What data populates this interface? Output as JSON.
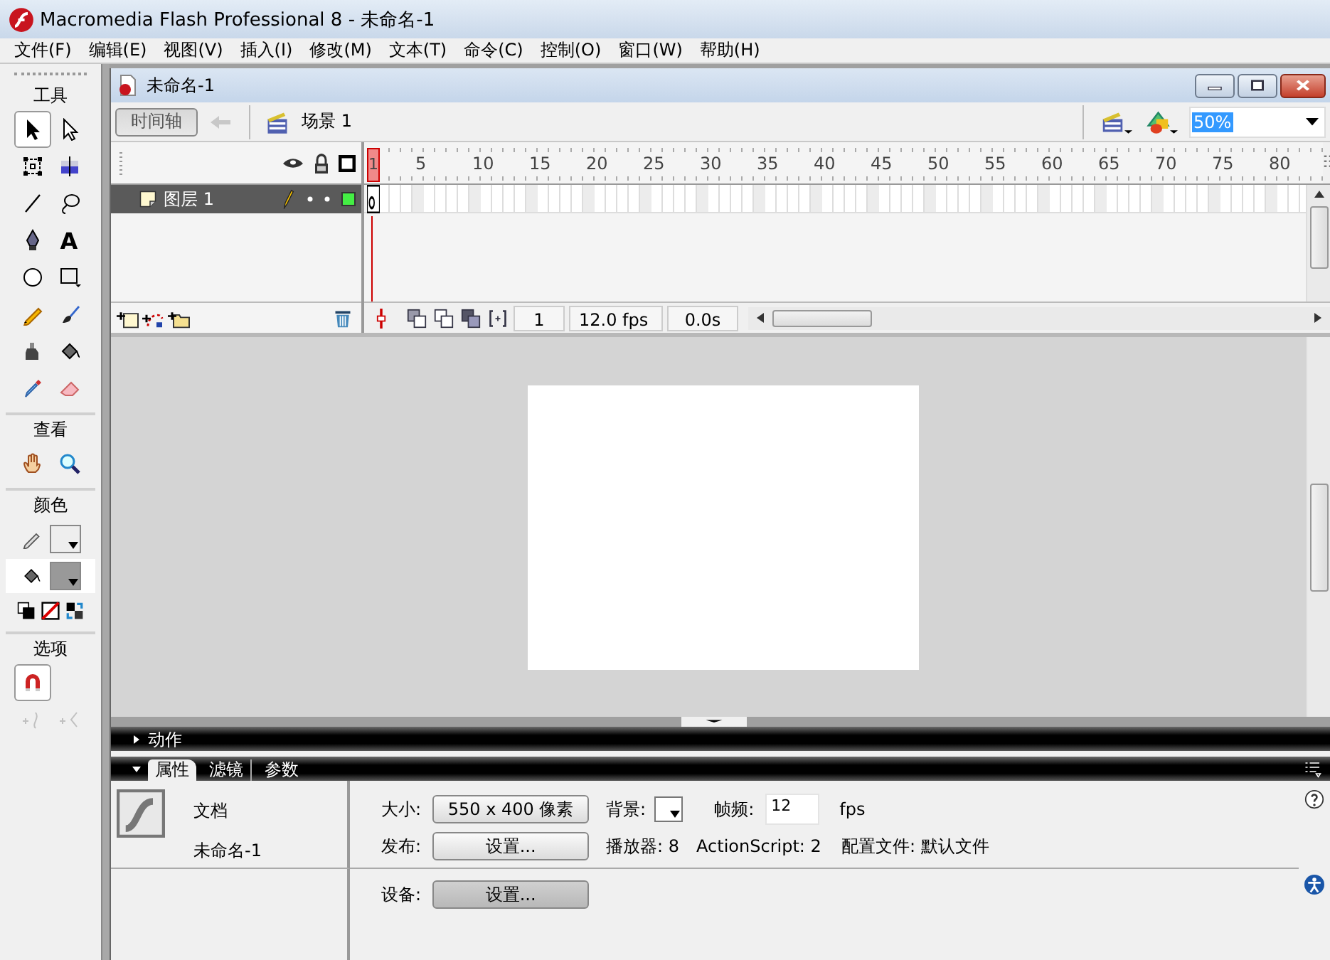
{
  "app": {
    "title": "Macromedia Flash Professional 8 - 未命名-1"
  },
  "menu": [
    "文件(F)",
    "编辑(E)",
    "视图(V)",
    "插入(I)",
    "修改(M)",
    "文本(T)",
    "命令(C)",
    "控制(O)",
    "窗口(W)",
    "帮助(H)"
  ],
  "toolbox": {
    "sections": [
      {
        "kind": "tools",
        "title": "工具",
        "tools": [
          {
            "selected": true
          },
          {
            "selected": false
          },
          {
            "selected": false
          },
          {
            "selected": false
          },
          {
            "selected": false
          },
          {
            "selected": false
          },
          {
            "selected": false
          },
          {
            "selected": false,
            "glyph": "A"
          },
          {
            "selected": false
          },
          {
            "selected": false
          },
          {
            "selected": false
          },
          {
            "selected": false
          },
          {
            "selected": false
          },
          {
            "selected": false
          },
          {
            "selected": false
          },
          {
            "selected": false
          }
        ]
      },
      {
        "kind": "tools",
        "title": "查看",
        "tools": [
          {
            "selected": false
          },
          {
            "selected": false
          }
        ]
      },
      {
        "kind": "colors",
        "title": "颜色",
        "swatches": [
          {
            "color": "#eeeeee"
          },
          {
            "color": "#999999"
          }
        ]
      },
      {
        "kind": "options",
        "title": "选项",
        "tools": [
          {
            "selected": true,
            "disabled": false
          },
          {
            "selected": false,
            "disabled": true
          },
          {
            "selected": false,
            "disabled": true
          }
        ]
      }
    ]
  },
  "document": {
    "title": "未命名-1",
    "timeline_button": "时间轴",
    "scene": "场景 1",
    "zoom": "50%"
  },
  "timeline": {
    "ruler": [
      "1",
      "5",
      "10",
      "15",
      "20",
      "25",
      "30",
      "35",
      "40",
      "45",
      "50",
      "55",
      "60",
      "65",
      "70",
      "75",
      "80"
    ],
    "layers": [
      {
        "name": "图层 1",
        "selected": true,
        "color": "#44ee44"
      }
    ],
    "frame": "1",
    "rate": "12.0 fps",
    "time": "0.0s"
  },
  "panels": [
    {
      "title": "动作",
      "expanded": false
    },
    {
      "expanded": true,
      "tabs": [
        {
          "label": "属性",
          "selected": true
        },
        {
          "label": "滤镜",
          "selected": false
        },
        {
          "label": "参数",
          "selected": false
        }
      ]
    }
  ],
  "properties": {
    "type": "文档",
    "name": "未命名-1",
    "size_label": "大小:",
    "size_button": "550 x 400 像素",
    "bg_label": "背景:",
    "fps_label": "帧频:",
    "fps_value": "12",
    "fps_unit": "fps",
    "publish_label": "发布:",
    "publish_button": "设置...",
    "player": "播放器: 8",
    "actionscript": "ActionScript: 2",
    "profile": "配置文件: 默认文件",
    "device_label": "设备:",
    "device_button": "设置..."
  }
}
